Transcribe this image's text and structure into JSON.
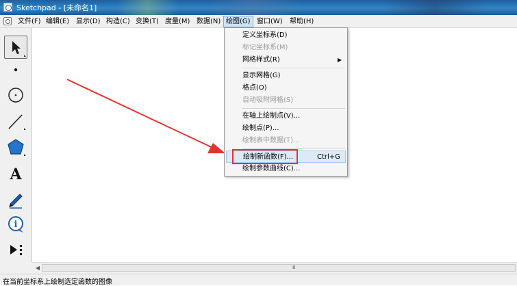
{
  "window": {
    "title": "Sketchpad - [未命名1]"
  },
  "menubar": {
    "items": [
      {
        "label": "文件(F)"
      },
      {
        "label": "编辑(E)"
      },
      {
        "label": "显示(D)"
      },
      {
        "label": "构造(C)"
      },
      {
        "label": "变换(T)"
      },
      {
        "label": "度量(M)"
      },
      {
        "label": "数据(N)"
      },
      {
        "label": "绘图(G)",
        "active": true
      },
      {
        "label": "窗口(W)"
      },
      {
        "label": "帮助(H)"
      }
    ]
  },
  "toolbox": {
    "tools": [
      {
        "icon": "arrow-select-icon",
        "selected": true
      },
      {
        "icon": "point-icon"
      },
      {
        "icon": "compass-circle-icon"
      },
      {
        "icon": "straightedge-icon"
      },
      {
        "icon": "polygon-icon"
      },
      {
        "icon": "text-icon",
        "glyph": "A"
      },
      {
        "icon": "marker-pen-icon"
      },
      {
        "icon": "information-icon",
        "glyph": "i"
      },
      {
        "icon": "custom-tools-icon"
      }
    ]
  },
  "graph_menu": {
    "items": [
      {
        "label": "定义坐标系(D)",
        "enabled": true
      },
      {
        "label": "标记坐标系(M)",
        "enabled": false
      },
      {
        "label": "网格样式(R)",
        "enabled": true,
        "submenu": true
      },
      {
        "label": "显示网格(G)",
        "enabled": true
      },
      {
        "label": "格点(O)",
        "enabled": true
      },
      {
        "label": "自动吸附网格(S)",
        "enabled": false
      },
      {
        "label": "在轴上绘制点(V)...",
        "enabled": true
      },
      {
        "label": "绘制点(P)...",
        "enabled": true
      },
      {
        "label": "绘制表中数据(T)...",
        "enabled": false
      },
      {
        "label": "绘制新函数(F)...",
        "enabled": true,
        "shortcut": "Ctrl+G",
        "highlighted": true
      },
      {
        "label": "绘制参数曲线(C)...",
        "enabled": true
      }
    ],
    "submenu_glyph": "▶"
  },
  "scrollbar": {
    "left_glyph": "◀",
    "grip_glyph": "III"
  },
  "status": {
    "text": "在当前坐标系上绘制选定函数的图像"
  },
  "colors": {
    "annotation_red": "#e8312f",
    "title_bar": "#2f86c8",
    "menu_highlight": "#dceaf8"
  }
}
